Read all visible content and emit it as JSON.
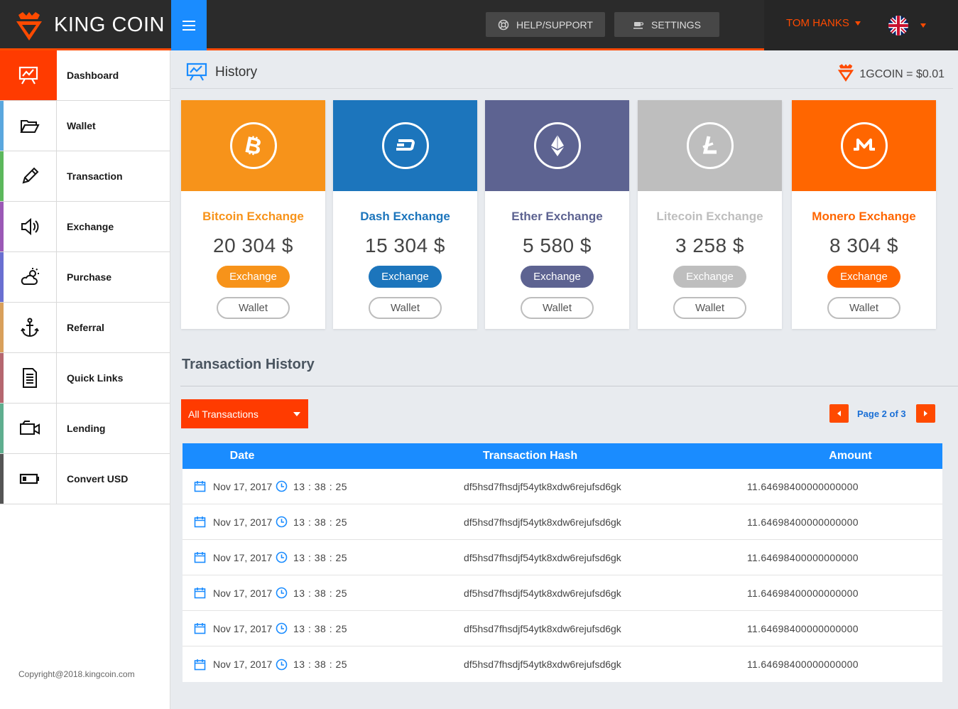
{
  "brand": {
    "name_bold": "KING",
    "name_light": "COIN"
  },
  "header": {
    "help_label": "HELP/SUPPORT",
    "settings_label": "SETTINGS",
    "user_name": "TOM HANKS",
    "language_icon": "uk-flag-icon"
  },
  "sidebar": {
    "items": [
      {
        "label": "Dashboard",
        "icon": "chart-board-icon",
        "color": "#ff3b00",
        "active": true
      },
      {
        "label": "Wallet",
        "icon": "folder-open-icon",
        "color": "#5aa7de"
      },
      {
        "label": "Transaction",
        "icon": "pencil-icon",
        "color": "#5cb85c"
      },
      {
        "label": "Exchange",
        "icon": "speaker-icon",
        "color": "#9b59b6"
      },
      {
        "label": "Purchase",
        "icon": "cloud-sun-icon",
        "color": "#6a6fd1"
      },
      {
        "label": "Referral",
        "icon": "anchor-icon",
        "color": "#d9a05b"
      },
      {
        "label": "Quick Links",
        "icon": "document-icon",
        "color": "#b5676f"
      },
      {
        "label": "Lending",
        "icon": "video-camera-icon",
        "color": "#5fae8f"
      },
      {
        "label": "Convert USD",
        "icon": "battery-icon",
        "color": "#555555"
      }
    ],
    "copyright": "Copyright@2018.kingcoin.com"
  },
  "page": {
    "title": "History",
    "rate": "1GCOIN = $0.01"
  },
  "cards": [
    {
      "title": "Bitcoin Exchange",
      "amount": "20 304 $",
      "color": "#f7931a",
      "icon": "bitcoin-icon",
      "exchange_label": "Exchange",
      "wallet_label": "Wallet"
    },
    {
      "title": "Dash Exchange",
      "amount": "15 304 $",
      "color": "#1c75bc",
      "icon": "dash-icon",
      "exchange_label": "Exchange",
      "wallet_label": "Wallet"
    },
    {
      "title": "Ether Exchange",
      "amount": "5 580 $",
      "color": "#5d6391",
      "icon": "ethereum-icon",
      "exchange_label": "Exchange",
      "wallet_label": "Wallet"
    },
    {
      "title": "Litecoin Exchange",
      "amount": "3 258 $",
      "color": "#bebebe",
      "icon": "litecoin-icon",
      "exchange_label": "Exchange",
      "wallet_label": "Wallet"
    },
    {
      "title": "Monero Exchange",
      "amount": "8 304 $",
      "color": "#ff6600",
      "icon": "monero-icon",
      "exchange_label": "Exchange",
      "wallet_label": "Wallet"
    }
  ],
  "transactions": {
    "title": "Transaction History",
    "filter": "All Transactions",
    "page_info": "Page 2 of 3",
    "columns": [
      "Date",
      "Transaction Hash",
      "Amount"
    ],
    "rows": [
      {
        "date": "Nov 17, 2017",
        "time": "13 : 38 : 25",
        "hash": "df5hsd7fhsdjf54ytk8xdw6rejufsd6gk",
        "amount": "11.64698400000000000"
      },
      {
        "date": "Nov 17, 2017",
        "time": "13 : 38 : 25",
        "hash": "df5hsd7fhsdjf54ytk8xdw6rejufsd6gk",
        "amount": "11.64698400000000000"
      },
      {
        "date": "Nov 17, 2017",
        "time": "13 : 38 : 25",
        "hash": "df5hsd7fhsdjf54ytk8xdw6rejufsd6gk",
        "amount": "11.64698400000000000"
      },
      {
        "date": "Nov 17, 2017",
        "time": "13 : 38 : 25",
        "hash": "df5hsd7fhsdjf54ytk8xdw6rejufsd6gk",
        "amount": "11.64698400000000000"
      },
      {
        "date": "Nov 17, 2017",
        "time": "13 : 38 : 25",
        "hash": "df5hsd7fhsdjf54ytk8xdw6rejufsd6gk",
        "amount": "11.64698400000000000"
      },
      {
        "date": "Nov 17, 2017",
        "time": "13 : 38 : 25",
        "hash": "df5hsd7fhsdjf54ytk8xdw6rejufsd6gk",
        "amount": "11.64698400000000000"
      }
    ]
  },
  "colors": {
    "accent": "#ff4a00",
    "blue": "#1a8cff",
    "dark": "#2b2b2b"
  }
}
